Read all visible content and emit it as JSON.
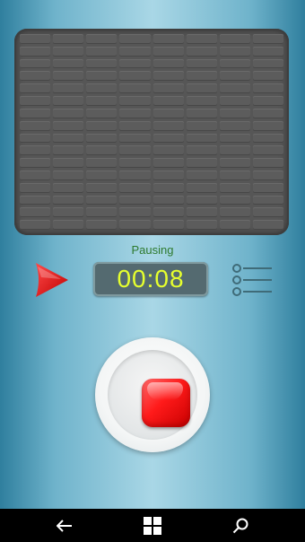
{
  "status": {
    "text": "Pausing",
    "color": "#2e7a2e"
  },
  "timer": {
    "value": "00:08",
    "color": "#e6ff2e"
  },
  "colors": {
    "record_accent": "#ff1a1a",
    "play_accent": "#e01010",
    "panel": "#565656"
  },
  "icons": {
    "play": "play-triangle-icon",
    "list": "recordings-list-icon",
    "stop": "stop-square-icon",
    "back": "back-arrow-icon",
    "windows": "windows-logo-icon",
    "search": "search-icon"
  }
}
